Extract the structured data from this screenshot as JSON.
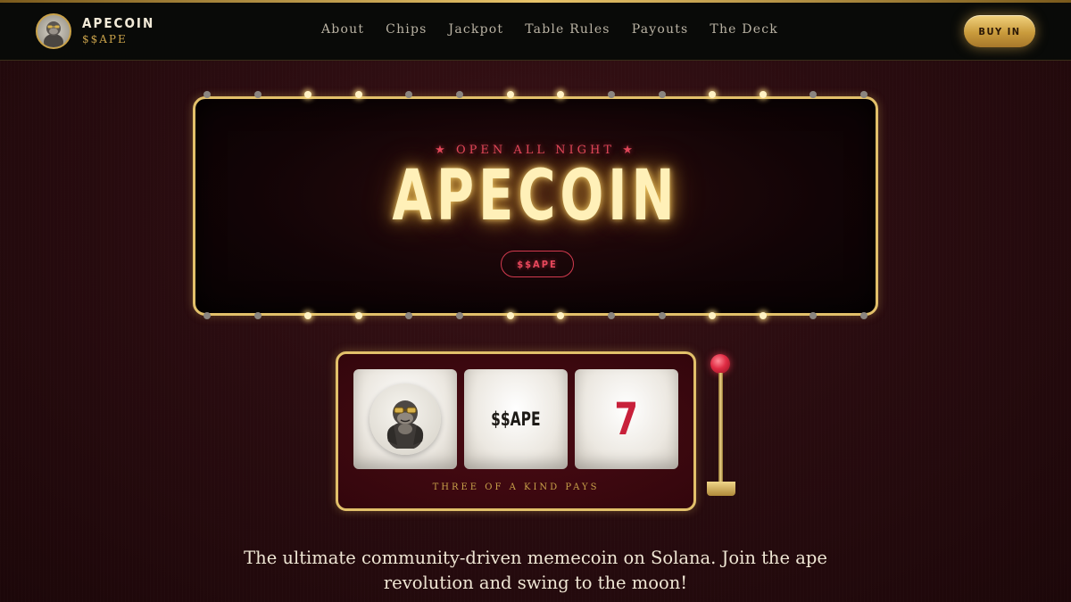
{
  "nav": {
    "brand_name": "APECOIN",
    "brand_ticker": "$$APE",
    "links": [
      "About",
      "Chips",
      "Jackpot",
      "Table Rules",
      "Payouts",
      "The Deck"
    ],
    "cta_label": "BUY IN",
    "logo_icon": "gorilla-icon"
  },
  "hero": {
    "tagline": "OPEN ALL NIGHT",
    "tagline_icon": "star-icon",
    "title": "APECOIN",
    "ticker_badge": "$$APE"
  },
  "slot": {
    "reels": [
      {
        "type": "icon",
        "icon": "gorilla-icon"
      },
      {
        "type": "text",
        "text": "$$APE"
      },
      {
        "type": "text",
        "text": "7"
      }
    ],
    "caption": "THREE OF A KIND PAYS",
    "lever_icon": "lever-icon"
  },
  "description": "The ultimate community-driven memecoin on Solana. Join the ape revolution and swing to the moon!",
  "colors": {
    "gold": "#e2c06a",
    "neon_red": "#e0465a",
    "neon_title": "#fff0b8",
    "background": "#2a0c10"
  }
}
